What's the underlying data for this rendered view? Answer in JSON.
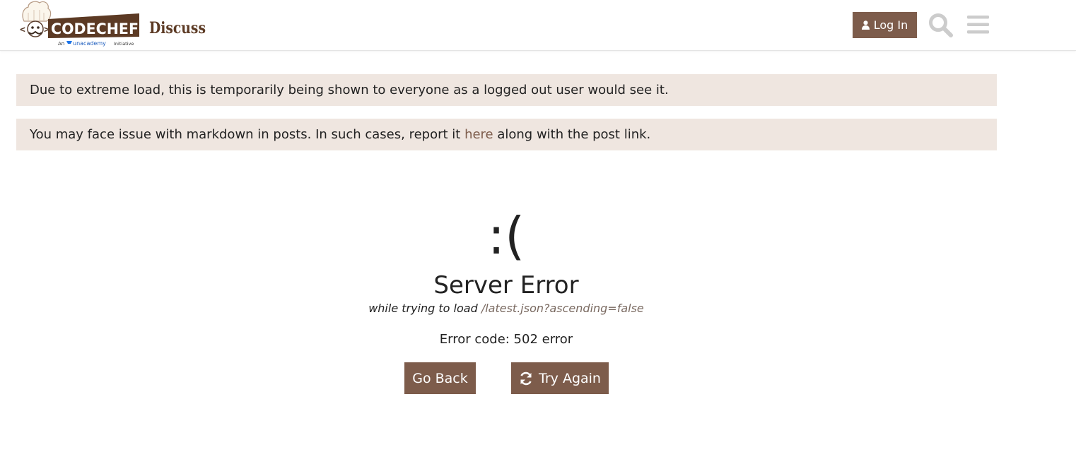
{
  "header": {
    "logo_text": "CODECHEF",
    "logo_sub_prefix": "An",
    "logo_sub_brand": "unacademy",
    "logo_sub_suffix": "Initiative",
    "site_name": "Discuss",
    "login_label": "Log In",
    "icons": {
      "user": "user-icon",
      "search": "search-icon",
      "menu": "hamburger-menu-icon"
    }
  },
  "notices": {
    "load_notice": "Due to extreme load, this is temporarily being shown to everyone as a logged out user would see it.",
    "markdown_prefix": "You may face issue with markdown in posts. In such cases, report it ",
    "markdown_link": "here",
    "markdown_suffix": " along with the post link."
  },
  "error": {
    "face": ":(",
    "title": "Server Error",
    "while_prefix": "while trying to load ",
    "url": "/latest.json?ascending=false",
    "code": "Error code: 502 error",
    "go_back_label": "Go Back",
    "try_again_label": "Try Again",
    "try_again_icon": "refresh-icon"
  },
  "colors": {
    "brand": "#7d5c4b",
    "notice_bg": "#efe6e0",
    "icon_gray": "#cccccc",
    "link": "#7d5c4b"
  }
}
